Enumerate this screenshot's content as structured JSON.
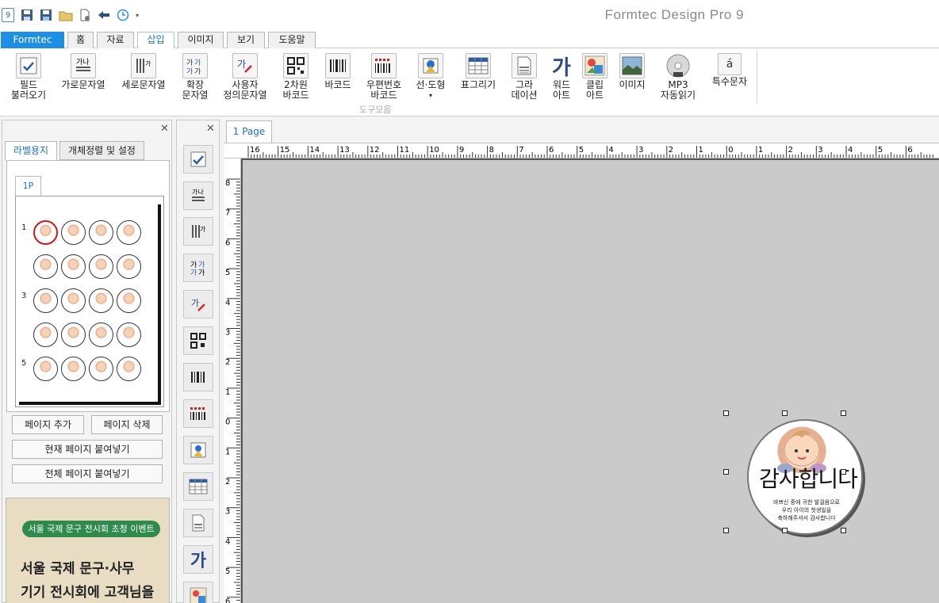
{
  "title_bar": {
    "app_title": "Formtec Design Pro 9",
    "quick_access": [
      "app-logo-icon",
      "save-icon",
      "save-as-icon",
      "open-folder-icon",
      "new-document-icon",
      "back-arrow-icon",
      "history-icon",
      "dropdown-arrow-icon"
    ]
  },
  "tabs": [
    {
      "label": "Formtec",
      "state": "app"
    },
    {
      "label": "홈",
      "state": "normal"
    },
    {
      "label": "자료",
      "state": "normal"
    },
    {
      "label": "삽입",
      "state": "active"
    },
    {
      "label": "이미지",
      "state": "normal"
    },
    {
      "label": "보기",
      "state": "normal"
    },
    {
      "label": "도움말",
      "state": "normal"
    }
  ],
  "ribbon": {
    "group_label": "도구모음",
    "buttons": [
      {
        "label": "필드\n불러오기",
        "icon": "field-load-icon"
      },
      {
        "label": "가로문자열",
        "icon": "horizontal-text-icon"
      },
      {
        "label": "세로문자열",
        "icon": "vertical-text-icon"
      },
      {
        "label": "확장\n문자열",
        "icon": "extended-text-icon"
      },
      {
        "label": "사용자\n정의문자열",
        "icon": "custom-text-icon"
      },
      {
        "label": "2차원\n바코드",
        "icon": "qr-code-icon"
      },
      {
        "label": "바코드",
        "icon": "barcode-icon"
      },
      {
        "label": "우편번호\n바코드",
        "icon": "postal-barcode-icon"
      },
      {
        "label": "선·도형",
        "icon": "shape-icon"
      },
      {
        "label": "표그리기",
        "icon": "table-icon"
      },
      {
        "label": "그라\n데이션",
        "icon": "gradation-icon"
      },
      {
        "label": "워드\n아트",
        "icon": "word-art-icon"
      },
      {
        "label": "클립\n아트",
        "icon": "clip-art-icon"
      },
      {
        "label": "이미지",
        "icon": "image-icon"
      },
      {
        "label": "MP3\n자동읽기",
        "icon": "mp3-icon"
      },
      {
        "label": "특수문자",
        "icon": "special-char-icon"
      }
    ]
  },
  "left_panel": {
    "tabs": [
      "라벨용지",
      "개체정렬 및 설정"
    ],
    "page_tab": "1P",
    "row_numbers": [
      "1",
      "3",
      "5"
    ],
    "buttons": {
      "add_page": "페이지 추가",
      "delete_page": "페이지 삭제",
      "paste_current": "현재 페이지 붙여넣기",
      "paste_all": "전체 페이지 붙여넣기"
    },
    "ad": {
      "pill": "서울 국제 문구 전시회 초청 이벤트",
      "line1": "서울 국제 문구·사무",
      "line2": "기기 전시회에 고객님을"
    }
  },
  "middle_toolbar": {
    "icons": [
      "field-load-icon",
      "horizontal-text-icon",
      "vertical-text-icon",
      "extended-text-icon",
      "custom-text-icon",
      "qr-code-icon",
      "barcode-icon",
      "postal-barcode-icon",
      "shape-icon",
      "table-icon",
      "gradation-icon",
      "word-art-icon",
      "clip-art-icon"
    ]
  },
  "canvas": {
    "page_tab": "1 Page",
    "h_ruler": [
      "16",
      "15",
      "14",
      "13",
      "12",
      "11",
      "10",
      "9",
      "8",
      "7",
      "6",
      "5",
      "4",
      "3",
      "2",
      "1",
      "0",
      "1",
      "2",
      "3",
      "4",
      "5",
      "6"
    ],
    "v_ruler": [
      "8",
      "7",
      "6",
      "5",
      "4",
      "3",
      "2",
      "1",
      "0",
      "1",
      "2",
      "3",
      "4",
      "5",
      "6"
    ],
    "label": {
      "big_text": "감사합니다",
      "small_lines": [
        "바쁘신 중에 귀한 발걸음으로",
        "우리 아이의 첫생일을",
        "축하해주셔서 감사합니다"
      ]
    }
  }
}
